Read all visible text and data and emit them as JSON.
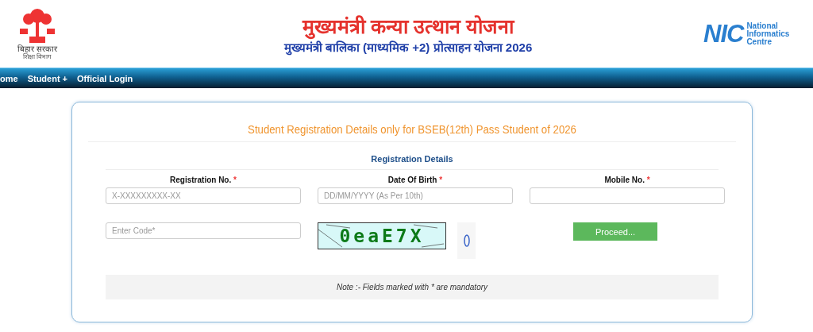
{
  "header": {
    "emblem_caption": "बिहार सरकार",
    "emblem_subcaption": "शिक्षा विभाग",
    "title": "मुख्यमंत्री कन्या उत्थान योजना",
    "subtitle": "मुख्यमंत्री बालिका (माध्यमिक +2) प्रोत्साहन योजना 2026",
    "nic_logo": "NIC",
    "nic_name": [
      "National",
      "Informatics",
      "Centre"
    ]
  },
  "nav": [
    {
      "label": "ome"
    },
    {
      "label": "Student +"
    },
    {
      "label": "Official Login"
    }
  ],
  "form": {
    "heading": "Student Registration Details only for BSEB(12th) Pass Student of 2026",
    "section": "Registration Details",
    "fields": [
      {
        "label": "Registration No.",
        "required": true,
        "placeholder": "X-XXXXXXXXX-XX"
      },
      {
        "label": "Date Of Birth",
        "required": true,
        "placeholder": "DD/MM/YYYY (As Per 10th)"
      },
      {
        "label": "Mobile No.",
        "required": true
      }
    ],
    "required_mark": "*",
    "code_placeholder": "Enter Code*",
    "captcha": "0eaE7X",
    "button": "Proceed...",
    "note": "Note :- Fields marked with * are mandatory"
  }
}
